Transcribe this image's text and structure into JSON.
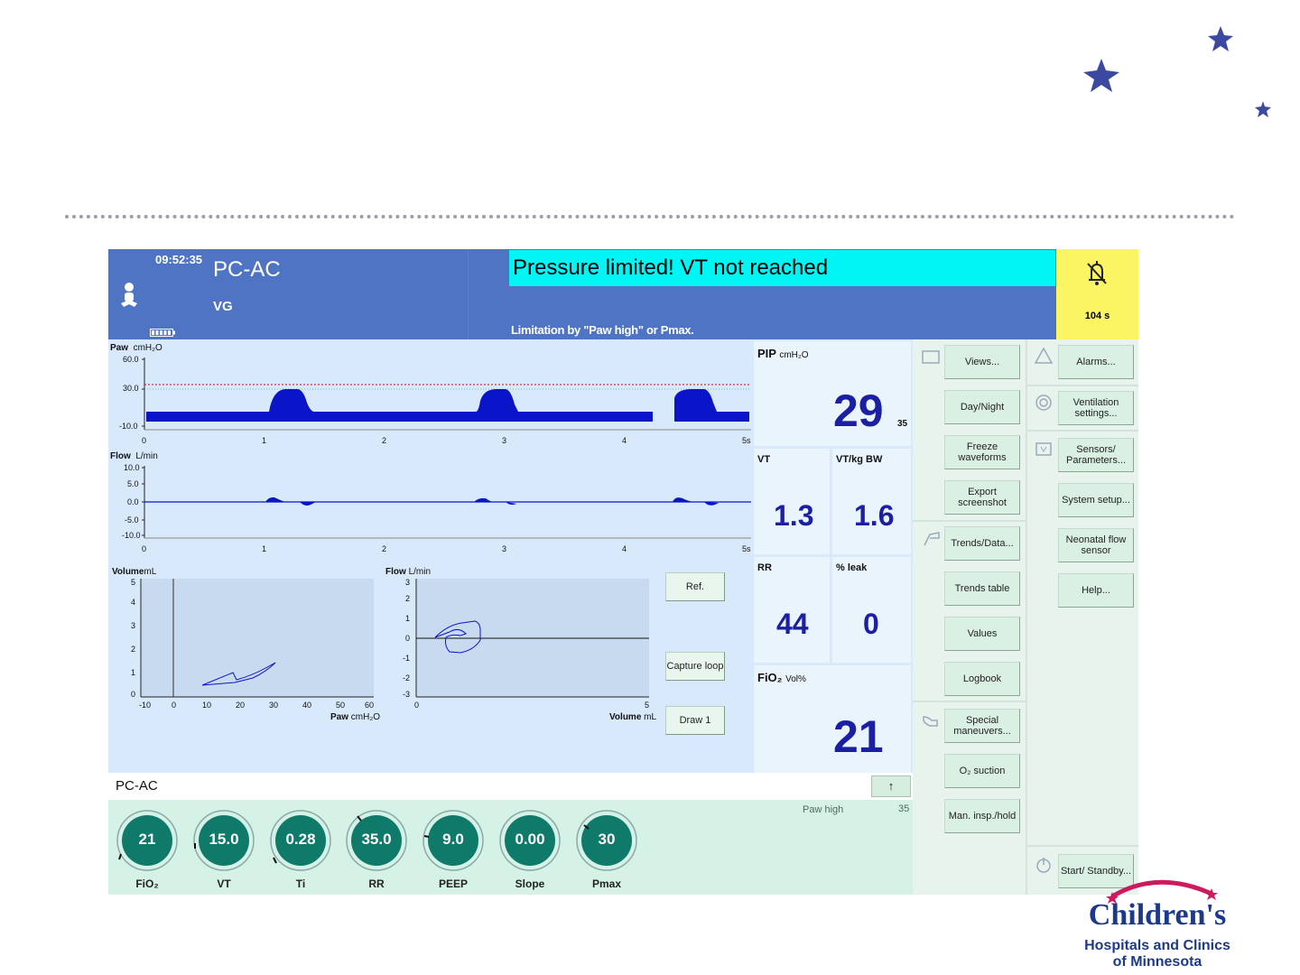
{
  "header": {
    "clock": "09:52:35",
    "mode": "PC-AC",
    "submode": "VG",
    "alarm_message": "Pressure limited! VT not reached",
    "alarm_detail": "Limitation by \"Paw high\" or Pmax.",
    "alarm_timer": "104 s"
  },
  "waveforms": {
    "paw": {
      "label": "Paw",
      "unit": "cmH₂O",
      "yticks": [
        "60.0",
        "30.0",
        "-10.0"
      ],
      "xticks": [
        "0",
        "1",
        "2",
        "3",
        "4",
        "5s"
      ]
    },
    "flow": {
      "label": "Flow",
      "unit": "L/min",
      "yticks": [
        "10.0",
        "5.0",
        "0.0",
        "-5.0",
        "-10.0"
      ],
      "xticks": [
        "0",
        "1",
        "2",
        "3",
        "4",
        "5s"
      ]
    }
  },
  "loops": {
    "pv": {
      "ylabel": "Volume",
      "yunit": "mL",
      "yticks": [
        "5",
        "4",
        "3",
        "2",
        "1",
        "0"
      ],
      "xticks": [
        "-10",
        "0",
        "10",
        "20",
        "30",
        "40",
        "50",
        "60"
      ],
      "xlabel": "Paw",
      "xunit": "cmH₂O"
    },
    "fv": {
      "ylabel": "Flow",
      "yunit": "L/min",
      "yticks": [
        "3",
        "2",
        "1",
        "0",
        "-1",
        "-2",
        "-3"
      ],
      "xticks": [
        "0",
        "5"
      ],
      "xlabel": "Volume",
      "xunit": "mL"
    },
    "buttons": {
      "ref": "Ref.",
      "capture": "Capture loop",
      "draw": "Draw 1"
    }
  },
  "measurements": {
    "pip": {
      "label": "PIP",
      "unit": "cmH₂O",
      "value": "29",
      "limit": "35"
    },
    "vt": {
      "label": "VT",
      "value": "1.3"
    },
    "vt_kg": {
      "label": "VT/kg BW",
      "value": "1.6"
    },
    "rr": {
      "label": "RR",
      "value": "44"
    },
    "leak": {
      "label": "% leak",
      "value": "0"
    },
    "fio2": {
      "label": "FiO₂",
      "unit": "Vol%",
      "value": "21"
    }
  },
  "menu": {
    "left": [
      "Views...",
      "Day/Night",
      "Freeze waveforms",
      "Export screenshot",
      "Trends/Data...",
      "Trends table",
      "Values",
      "Logbook",
      "Special maneuvers...",
      "O₂ suction",
      "Man. insp./hold"
    ],
    "right": [
      "Alarms...",
      "Ventilation settings...",
      "Sensors/ Parameters...",
      "System setup...",
      "Neonatal flow sensor",
      "Help...",
      "Start/ Standby..."
    ]
  },
  "settings": {
    "mode_label": "PC-AC",
    "arrow": "↑",
    "knobs": [
      {
        "label": "FiO₂",
        "value": "21"
      },
      {
        "label": "VT",
        "value": "15.0"
      },
      {
        "label": "Ti",
        "value": "0.28"
      },
      {
        "label": "RR",
        "value": "35.0"
      },
      {
        "label": "PEEP",
        "value": "9.0"
      },
      {
        "label": "Slope",
        "value": "0.00"
      },
      {
        "label": "Pmax",
        "value": "30"
      }
    ],
    "paw_high_label": "Paw high",
    "paw_high_value": "35"
  },
  "logo": {
    "line1": "Children's",
    "line2": "Hospitals and Clinics",
    "line3": "of Minnesota"
  },
  "colors": {
    "header_blue": "#4f74c4",
    "alarm_cyan": "#00f5f5",
    "alarm_yellow": "#fbf563",
    "waveform_blue": "#0a14c8",
    "value_blue": "#1b1fa3",
    "knob_teal": "#0f7a6a",
    "logo_navy": "#1d3a8a",
    "logo_pink": "#d0185f"
  }
}
